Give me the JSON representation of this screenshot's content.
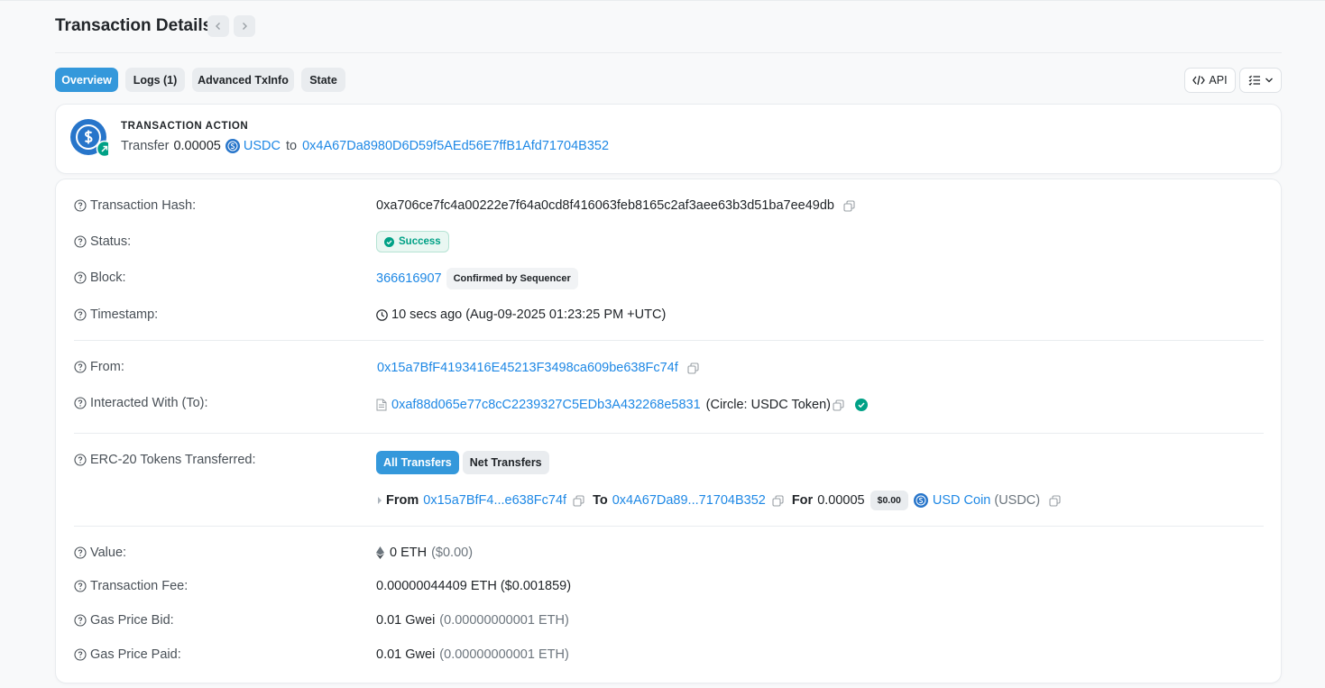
{
  "page": {
    "title": "Transaction Details"
  },
  "tabs": [
    {
      "label": "Overview"
    },
    {
      "label": "Logs (1)"
    },
    {
      "label": "Advanced TxInfo"
    },
    {
      "label": "State"
    }
  ],
  "tools": {
    "api_label": "API"
  },
  "action": {
    "heading": "TRANSACTION ACTION",
    "verb": "Transfer",
    "amount": "0.00005",
    "token": "USDC",
    "to_word": "to",
    "to_address": "0x4A67Da8980D6D59f5AEd56E7ffB1Afd71704B352"
  },
  "rows": {
    "hash": {
      "label": "Transaction Hash:",
      "value": "0xa706ce7fc4a00222e7f64a0cd8f416063feb8165c2af3aee63b3d51ba7ee49db"
    },
    "status": {
      "label": "Status:",
      "value": "Success"
    },
    "block": {
      "label": "Block:",
      "value": "366616907",
      "badge": "Confirmed by Sequencer"
    },
    "timestamp": {
      "label": "Timestamp:",
      "value": "10 secs ago (Aug-09-2025 01:23:25 PM +UTC)"
    },
    "from": {
      "label": "From:",
      "value": "0x15a7BfF4193416E45213F3498ca609be638Fc74f"
    },
    "to": {
      "label": "Interacted With (To):",
      "address": "0xaf88d065e77c8cC2239327C5EDb3A432268e5831",
      "name": "(Circle: USDC Token)"
    },
    "erc20": {
      "label": "ERC-20 Tokens Transferred:",
      "filter_all": "All Transfers",
      "filter_net": "Net Transfers",
      "from_word": "From",
      "from_address": "0x15a7BfF4...e638Fc74f",
      "to_word": "To",
      "to_address": "0x4A67Da89...71704B352",
      "for_word": "For",
      "amount": "0.00005",
      "price": "$0.00",
      "token_name": "USD Coin",
      "token_symbol": "(USDC)"
    },
    "value": {
      "label": "Value:",
      "amount": "0 ETH",
      "usd": "($0.00)"
    },
    "fee": {
      "label": "Transaction Fee:",
      "value": "0.00000044409 ETH ($0.001859)"
    },
    "gas_bid": {
      "label": "Gas Price Bid:",
      "gwei": "0.01 Gwei",
      "eth": "(0.00000000001 ETH)"
    },
    "gas_paid": {
      "label": "Gas Price Paid:",
      "gwei": "0.01 Gwei",
      "eth": "(0.00000000001 ETH)"
    }
  },
  "colors": {
    "accent": "#3498db",
    "link": "#1e88e5",
    "success": "#00a186",
    "usdc": "#2775ca"
  }
}
